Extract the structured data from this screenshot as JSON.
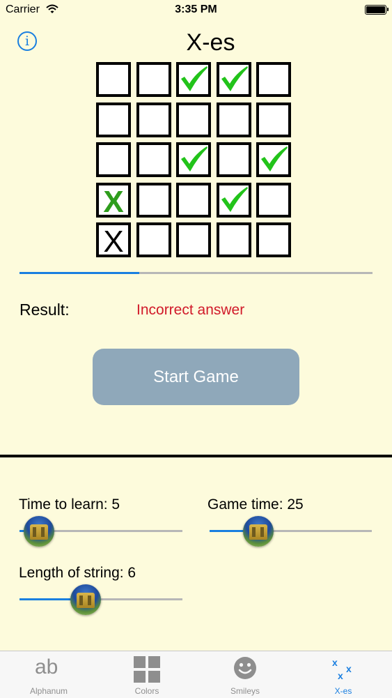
{
  "status_bar": {
    "carrier": "Carrier",
    "time": "3:35 PM"
  },
  "header": {
    "title": "X-es",
    "info_icon": "info-icon"
  },
  "grid": {
    "rows": [
      [
        "empty",
        "empty",
        "check",
        "check",
        "empty"
      ],
      [
        "empty",
        "empty",
        "empty",
        "empty",
        "empty"
      ],
      [
        "empty",
        "empty",
        "check",
        "empty",
        "check"
      ],
      [
        "x-green",
        "empty",
        "empty",
        "check",
        "empty"
      ],
      [
        "x-black",
        "empty",
        "empty",
        "empty",
        "empty"
      ]
    ]
  },
  "progress": {
    "fraction": 0.34
  },
  "result": {
    "label": "Result:",
    "value": "Incorrect answer"
  },
  "start_button": {
    "label": "Start Game"
  },
  "settings": {
    "time_to_learn": {
      "label": "Time to learn: 5",
      "fraction": 0.06
    },
    "game_time": {
      "label": "Game time: 25",
      "fraction": 0.27
    },
    "length_of_string": {
      "label": "Length of string: 6",
      "fraction": 0.39
    }
  },
  "tabs": [
    {
      "label": "Alphanum",
      "icon": "ab-icon",
      "active": false
    },
    {
      "label": "Colors",
      "icon": "grid-icon",
      "active": false
    },
    {
      "label": "Smileys",
      "icon": "smiley-icon",
      "active": false
    },
    {
      "label": "X-es",
      "icon": "xes-icon",
      "active": true
    }
  ],
  "colors": {
    "accent": "#1a7fe0",
    "background": "#fdfbdc",
    "error": "#d11a2a",
    "check": "#22c31a",
    "x_green": "#2e9d1c",
    "button": "#8fa8ba"
  }
}
